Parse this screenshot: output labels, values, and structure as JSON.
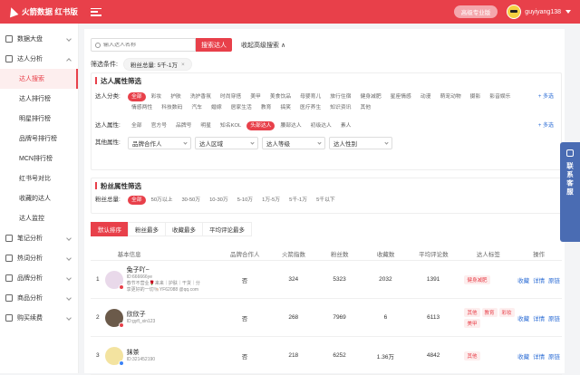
{
  "header": {
    "logo_text": "火箭数据 红书版",
    "vip_label": "高级专业版",
    "username": "guyiyang138"
  },
  "sidebar": {
    "groups": [
      {
        "label": "数据大盘"
      },
      {
        "label": "达人分析",
        "subs": [
          "达人搜索",
          "达人排行榜",
          "明星排行榜",
          "品牌号排行榜",
          "MCN排行榜",
          "红书号对比",
          "收藏的达人",
          "达人监控"
        ]
      },
      {
        "label": "笔记分析"
      },
      {
        "label": "热词分析"
      },
      {
        "label": "品牌分析"
      },
      {
        "label": "商品分析"
      },
      {
        "label": "购买续费"
      }
    ]
  },
  "search": {
    "placeholder": "输入达人名称",
    "button": "搜索达人",
    "advanced": "收起高级搜索 ∧"
  },
  "conditions": {
    "label": "筛选条件:",
    "tag": "粉丝总量: 5千-1万",
    "close": "×"
  },
  "attr_panel": {
    "title": "达人属性筛选",
    "category_label": "达人分类:",
    "categories": [
      "全部",
      "彩妆",
      "护肤",
      "洗护香氛",
      "时尚穿搭",
      "美甲",
      "美食饮品",
      "母婴育儿",
      "旅行住宿",
      "健身减肥",
      "星座情感",
      "动漫",
      "萌宠动物",
      "摄影",
      "影音娱乐",
      "情感两性",
      "科技数码",
      "汽车",
      "婚嫁",
      "居家生活",
      "教育",
      "搞笑",
      "医疗养生",
      "知识资讯",
      "其他"
    ],
    "more": "+ 多选",
    "attr_label": "达人属性:",
    "attrs": [
      "全部",
      "官方号",
      "品牌号",
      "明星",
      "知名KOL",
      "头部达人",
      "腰部达人",
      "初级达人",
      "素人"
    ],
    "other_label": "其他属性:",
    "selects": [
      "品牌合作人",
      "达人区域",
      "达人等级",
      "达人性别"
    ]
  },
  "fans_panel": {
    "title": "粉丝属性筛选",
    "fans_label": "粉丝总量:",
    "fans_opts": [
      "全部",
      "50万以上",
      "30-50万",
      "10-30万",
      "5-10万",
      "1万-5万",
      "5千-1万",
      "5千以下"
    ]
  },
  "tabs": [
    "默认排序",
    "粉丝最多",
    "收藏最多",
    "平均评论最多"
  ],
  "table": {
    "headers": [
      "基本信息",
      "品牌合作人",
      "火箭指数",
      "粉丝数",
      "收藏数",
      "平均评论数",
      "达人标签",
      "操作"
    ],
    "ops": [
      "收藏",
      "详情",
      "原链"
    ],
    "rows": [
      {
        "idx": "1",
        "name": "兔子吖~",
        "id": "ID:666666ye",
        "desc1": "春节不营业🌹来来｜护肤｜干货｜分",
        "desc2": "享更好的一切🐚YF62088 @qq.com",
        "coop": "否",
        "index": "324",
        "fans": "5323",
        "fav": "2032",
        "avg": "1391",
        "tags": [
          "健身减肥"
        ],
        "color": "#e9d9ea"
      },
      {
        "idx": "2",
        "name": "欣欣子",
        "id": "ID:gyfl_xin123",
        "desc1": "",
        "desc2": "",
        "coop": "否",
        "index": "268",
        "fans": "7969",
        "fav": "6",
        "avg": "6113",
        "tags": [
          "其他",
          "教育",
          "彩妆",
          "美甲"
        ],
        "color": "#6b5a4a"
      },
      {
        "idx": "3",
        "name": "抹茶",
        "id": "ID:321452190",
        "desc1": "",
        "desc2": "",
        "coop": "否",
        "index": "218",
        "fans": "6252",
        "fav": "1.36万",
        "avg": "4842",
        "tags": [
          "其他"
        ],
        "color": "#f3e3a0"
      }
    ]
  },
  "float": {
    "label": "联系客服"
  }
}
